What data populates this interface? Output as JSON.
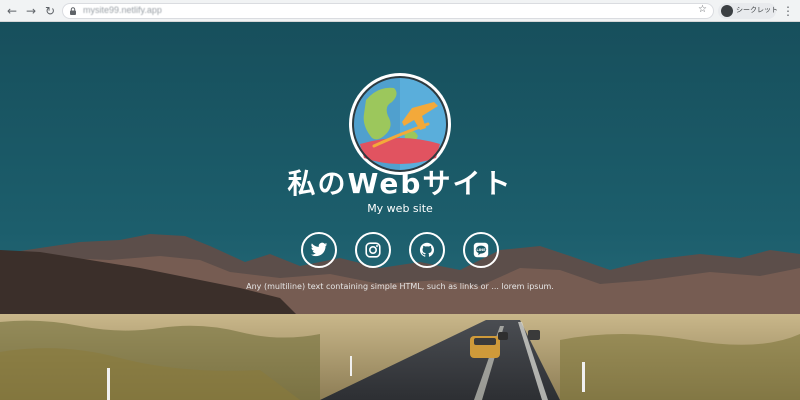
{
  "browser": {
    "url": "mysite99.netlify.app",
    "incognito_label": "シークレット",
    "back_icon": "arrow-left-icon",
    "forward_icon": "arrow-right-icon",
    "reload_icon": "reload-icon",
    "bookmark_icon": "star-icon",
    "menu_icon": "kebab-menu-icon"
  },
  "hero": {
    "title": "私のWebサイト",
    "subtitle": "My web site",
    "description": "Any (multiline) text containing simple HTML, such as links or ... lorem ipsum.",
    "logo_icon": "globe-airplane-logo"
  },
  "social": [
    {
      "name": "twitter",
      "icon": "twitter-icon"
    },
    {
      "name": "instagram",
      "icon": "instagram-icon"
    },
    {
      "name": "github",
      "icon": "github-icon"
    },
    {
      "name": "line",
      "icon": "line-icon"
    }
  ],
  "colors": {
    "sky": "#1b5865",
    "logo_ocean": "#5aaedb",
    "logo_land": "#9cc75c",
    "logo_banner": "#e15360",
    "logo_plane": "#f3a93a"
  }
}
